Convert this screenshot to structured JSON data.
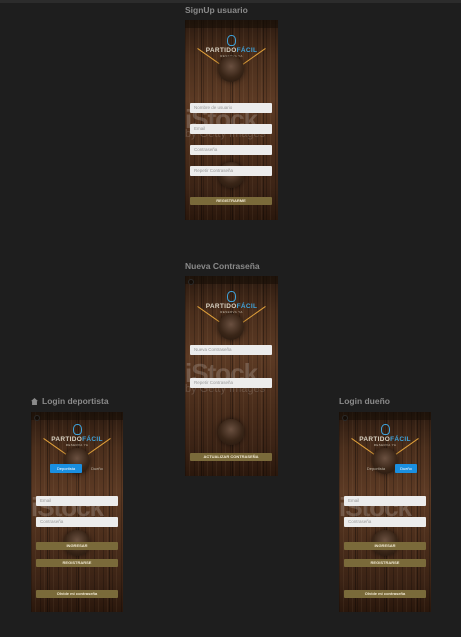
{
  "frames": {
    "signup": {
      "title": "SignUp usuario",
      "logo": {
        "brand_left": "PARTIDO",
        "brand_right": "FÁCIL",
        "tagline": "RESERVA YA"
      },
      "watermark": "iStock",
      "watermark_sub": "by Getty Images",
      "fields": {
        "username_placeholder": "Nombre de usuario",
        "email_placeholder": "Email",
        "password_placeholder": "Contraseña",
        "repeat_password_placeholder": "Repetir Contraseña"
      },
      "register_label": "REGISTRARME"
    },
    "reset_password": {
      "title": "Nueva Contraseña",
      "logo": {
        "brand_left": "PARTIDO",
        "brand_right": "FÁCIL",
        "tagline": "RESERVA YA"
      },
      "watermark": "iStock",
      "watermark_sub": "by Getty Images",
      "fields": {
        "new_password_placeholder": "Nueva Contraseña",
        "repeat_password_placeholder": "Repetir Contraseña"
      },
      "update_label": "ACTUALIZAR CONTRASEÑA"
    },
    "login_athlete": {
      "title": "Login deportista",
      "logo": {
        "brand_left": "PARTIDO",
        "brand_right": "FÁCIL",
        "tagline": "RESERVA YA"
      },
      "watermark": "iStock",
      "toggle": {
        "option_a": "Deportista",
        "option_b": "Dueño",
        "selected": "Deportista"
      },
      "fields": {
        "email_placeholder": "Email",
        "password_placeholder": "Contraseña"
      },
      "login_label": "INGRESAR",
      "register_label": "REGISTRARSE",
      "forgot_label": "Olvide mi contraseña"
    },
    "login_owner": {
      "title": "Login dueño",
      "logo": {
        "brand_left": "PARTIDO",
        "brand_right": "FÁCIL",
        "tagline": "RESERVA YA"
      },
      "watermark": "iStock",
      "toggle": {
        "option_a": "Deportista",
        "option_b": "Dueño",
        "selected": "Dueño"
      },
      "fields": {
        "email_placeholder": "Email",
        "password_placeholder": "Contraseña"
      },
      "login_label": "INGRESAR",
      "register_label": "REGISTRARSE",
      "forgot_label": "Olvide mi contraseña"
    }
  },
  "colors": {
    "canvas_bg": "#1e1e1e",
    "frame_label": "#8a8a8a",
    "brand_blue": "#3ea3dc",
    "toggle_active": "#1a8fe0",
    "button_olive": "#7a6a3a",
    "field_bg": "#ececec",
    "spotlight_rays": "#e0a03a"
  },
  "icons": [
    "home-icon",
    "back-icon",
    "football-icon"
  ]
}
